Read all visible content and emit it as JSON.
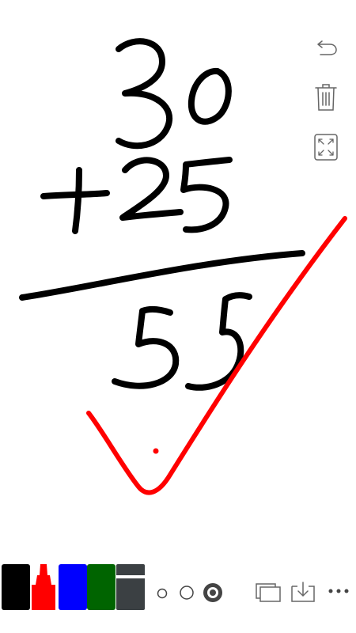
{
  "sidebar": {
    "tools": [
      {
        "icon": "undo-icon"
      },
      {
        "icon": "trash-icon"
      },
      {
        "icon": "fullscreen-icon"
      }
    ]
  },
  "colors": {
    "ink_black": "#000000",
    "ink_red": "#ff0000",
    "marker_black": "#000000",
    "marker_red": "#ff0000",
    "marker_blue": "#0000ff",
    "marker_green": "#006400",
    "marker_gray": "#3b4043",
    "icon_gray": "#666666"
  },
  "toolbar": {
    "markers": [
      {
        "icon": "black-marker-icon",
        "color": "#000000"
      },
      {
        "icon": "red-marker-icon",
        "color": "#ff0000",
        "selected": true
      },
      {
        "icon": "blue-marker-icon",
        "color": "#0000ff"
      },
      {
        "icon": "green-marker-icon",
        "color": "#006400"
      },
      {
        "icon": "eraser-icon",
        "color": "#3b4043"
      }
    ],
    "brush_sizes": [
      "small",
      "medium",
      "large"
    ],
    "selected_brush_size": "large",
    "actions": [
      {
        "icon": "pages-icon"
      },
      {
        "icon": "download-icon"
      },
      {
        "icon": "more-icon"
      }
    ]
  }
}
